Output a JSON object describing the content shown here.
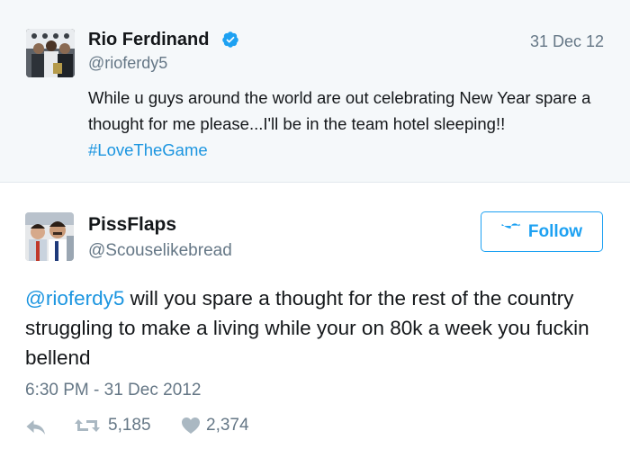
{
  "quoted_tweet": {
    "author_name": "Rio Ferdinand",
    "author_handle": "@rioferdy5",
    "date": "31 Dec 12",
    "text_main": "While u guys around the world are out celebrating New Year spare a thought for me please...I'll be in the team hotel sleeping!! ",
    "hashtag": "#LoveTheGame",
    "verified_icon": "verified-badge-icon"
  },
  "tweet": {
    "author_name": "PissFlaps",
    "author_handle": "@Scouselikebread",
    "follow_label": "Follow",
    "mention": "@rioferdy5",
    "text_main": " will you spare a thought for the rest of the country struggling to make a living while your on 80k a week you fuckin bellend",
    "timestamp": "6:30 PM - 31 Dec 2012",
    "retweet_count": "5,185",
    "like_count": "2,374"
  },
  "colors": {
    "accent": "#1da1f2",
    "link": "#1b95e0",
    "muted": "#657786",
    "quoted_bg": "#f5f8fa"
  }
}
